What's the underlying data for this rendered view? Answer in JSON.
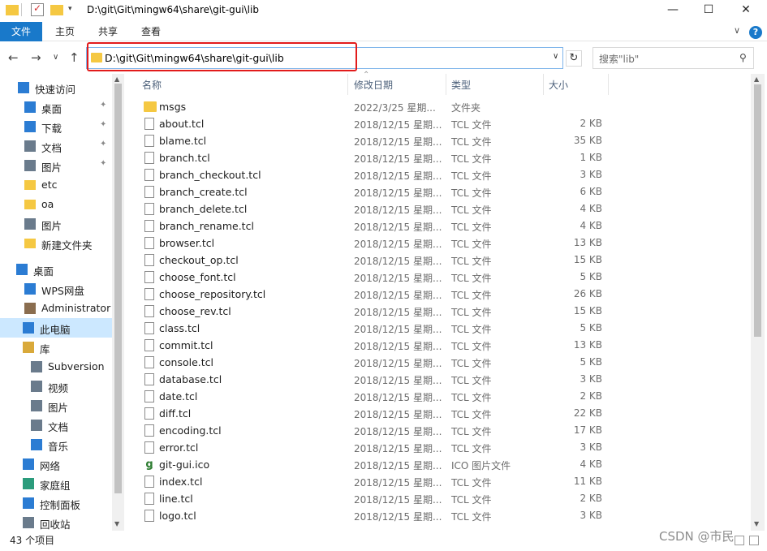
{
  "window": {
    "title": "D:\\git\\Git\\mingw64\\share\\git-gui\\lib",
    "minimize": "—",
    "maximize": "☐",
    "close": "✕"
  },
  "ribbon": {
    "file": "文件",
    "tabs": [
      "主页",
      "共享",
      "查看"
    ],
    "expand": "∨",
    "help": "?"
  },
  "nav": {
    "back": "←",
    "forward": "→",
    "recent": "∨",
    "up": "↑",
    "address": "D:\\git\\Git\\mingw64\\share\\git-gui\\lib",
    "address_dropdown": "∨",
    "refresh": "↻",
    "search_placeholder": "搜索\"lib\"",
    "search_icon": "⚲"
  },
  "sidebar": {
    "items": [
      {
        "label": "快速访问",
        "icon": "star-icon",
        "pinned": false
      },
      {
        "label": "桌面",
        "icon": "desktop-icon",
        "pinned": true
      },
      {
        "label": "下载",
        "icon": "download-icon",
        "pinned": true
      },
      {
        "label": "文档",
        "icon": "document-icon",
        "pinned": true
      },
      {
        "label": "图片",
        "icon": "picture-icon",
        "pinned": true
      },
      {
        "label": "etc",
        "icon": "folder-icon",
        "pinned": false
      },
      {
        "label": "oa",
        "icon": "folder-icon",
        "pinned": false
      },
      {
        "label": "图片",
        "icon": "picture-icon",
        "pinned": false
      },
      {
        "label": "新建文件夹",
        "icon": "folder-icon",
        "pinned": false
      },
      {
        "label": "桌面",
        "icon": "desktop-icon",
        "pinned": false
      },
      {
        "label": "WPS网盘",
        "icon": "cloud-icon",
        "pinned": false
      },
      {
        "label": "Administrator",
        "icon": "user-icon",
        "pinned": false
      },
      {
        "label": "此电脑",
        "icon": "computer-icon",
        "pinned": false
      },
      {
        "label": "库",
        "icon": "library-icon",
        "pinned": false
      },
      {
        "label": "Subversion",
        "icon": "subversion-icon",
        "pinned": false
      },
      {
        "label": "视频",
        "icon": "video-icon",
        "pinned": false
      },
      {
        "label": "图片",
        "icon": "picture-icon",
        "pinned": false
      },
      {
        "label": "文档",
        "icon": "document-icon",
        "pinned": false
      },
      {
        "label": "音乐",
        "icon": "music-icon",
        "pinned": false
      },
      {
        "label": "网络",
        "icon": "network-icon",
        "pinned": false
      },
      {
        "label": "家庭组",
        "icon": "homegroup-icon",
        "pinned": false
      },
      {
        "label": "控制面板",
        "icon": "control-panel-icon",
        "pinned": false
      },
      {
        "label": "回收站",
        "icon": "recycle-bin-icon",
        "pinned": false
      }
    ],
    "selected_label": "此电脑"
  },
  "columns": {
    "name": "名称",
    "date": "修改日期",
    "type": "类型",
    "size": "大小"
  },
  "files": [
    {
      "name": "msgs",
      "date": "2022/3/25 星期...",
      "type": "文件夹",
      "size": "",
      "kind": "folder"
    },
    {
      "name": "about.tcl",
      "date": "2018/12/15 星期...",
      "type": "TCL 文件",
      "size": "2 KB",
      "kind": "file"
    },
    {
      "name": "blame.tcl",
      "date": "2018/12/15 星期...",
      "type": "TCL 文件",
      "size": "35 KB",
      "kind": "file"
    },
    {
      "name": "branch.tcl",
      "date": "2018/12/15 星期...",
      "type": "TCL 文件",
      "size": "1 KB",
      "kind": "file"
    },
    {
      "name": "branch_checkout.tcl",
      "date": "2018/12/15 星期...",
      "type": "TCL 文件",
      "size": "3 KB",
      "kind": "file"
    },
    {
      "name": "branch_create.tcl",
      "date": "2018/12/15 星期...",
      "type": "TCL 文件",
      "size": "6 KB",
      "kind": "file"
    },
    {
      "name": "branch_delete.tcl",
      "date": "2018/12/15 星期...",
      "type": "TCL 文件",
      "size": "4 KB",
      "kind": "file"
    },
    {
      "name": "branch_rename.tcl",
      "date": "2018/12/15 星期...",
      "type": "TCL 文件",
      "size": "4 KB",
      "kind": "file"
    },
    {
      "name": "browser.tcl",
      "date": "2018/12/15 星期...",
      "type": "TCL 文件",
      "size": "13 KB",
      "kind": "file"
    },
    {
      "name": "checkout_op.tcl",
      "date": "2018/12/15 星期...",
      "type": "TCL 文件",
      "size": "15 KB",
      "kind": "file"
    },
    {
      "name": "choose_font.tcl",
      "date": "2018/12/15 星期...",
      "type": "TCL 文件",
      "size": "5 KB",
      "kind": "file"
    },
    {
      "name": "choose_repository.tcl",
      "date": "2018/12/15 星期...",
      "type": "TCL 文件",
      "size": "26 KB",
      "kind": "file"
    },
    {
      "name": "choose_rev.tcl",
      "date": "2018/12/15 星期...",
      "type": "TCL 文件",
      "size": "15 KB",
      "kind": "file"
    },
    {
      "name": "class.tcl",
      "date": "2018/12/15 星期...",
      "type": "TCL 文件",
      "size": "5 KB",
      "kind": "file"
    },
    {
      "name": "commit.tcl",
      "date": "2018/12/15 星期...",
      "type": "TCL 文件",
      "size": "13 KB",
      "kind": "file"
    },
    {
      "name": "console.tcl",
      "date": "2018/12/15 星期...",
      "type": "TCL 文件",
      "size": "5 KB",
      "kind": "file"
    },
    {
      "name": "database.tcl",
      "date": "2018/12/15 星期...",
      "type": "TCL 文件",
      "size": "3 KB",
      "kind": "file"
    },
    {
      "name": "date.tcl",
      "date": "2018/12/15 星期...",
      "type": "TCL 文件",
      "size": "2 KB",
      "kind": "file"
    },
    {
      "name": "diff.tcl",
      "date": "2018/12/15 星期...",
      "type": "TCL 文件",
      "size": "22 KB",
      "kind": "file"
    },
    {
      "name": "encoding.tcl",
      "date": "2018/12/15 星期...",
      "type": "TCL 文件",
      "size": "17 KB",
      "kind": "file"
    },
    {
      "name": "error.tcl",
      "date": "2018/12/15 星期...",
      "type": "TCL 文件",
      "size": "3 KB",
      "kind": "file"
    },
    {
      "name": "git-gui.ico",
      "date": "2018/12/15 星期...",
      "type": "ICO 图片文件",
      "size": "4 KB",
      "kind": "ico"
    },
    {
      "name": "index.tcl",
      "date": "2018/12/15 星期...",
      "type": "TCL 文件",
      "size": "11 KB",
      "kind": "file"
    },
    {
      "name": "line.tcl",
      "date": "2018/12/15 星期...",
      "type": "TCL 文件",
      "size": "2 KB",
      "kind": "file"
    },
    {
      "name": "logo.tcl",
      "date": "2018/12/15 星期...",
      "type": "TCL 文件",
      "size": "3 KB",
      "kind": "file"
    }
  ],
  "status": {
    "item_count": "43 个项目"
  },
  "watermark": "CSDN @市民",
  "colors": {
    "accent": "#1979ca",
    "highlight_box": "#e21b1b",
    "selected_bg": "#cce8ff",
    "folder": "#f5c842"
  }
}
